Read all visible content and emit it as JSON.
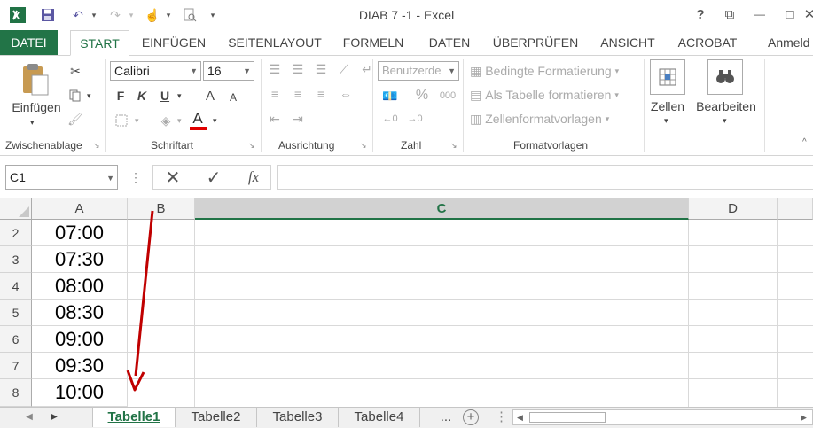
{
  "titlebar": {
    "title": "DIAB 7 -1 - Excel",
    "help": "?",
    "restore": "⧉",
    "minimize": "—",
    "maximize": "□",
    "close": "✕"
  },
  "tabs": {
    "datei": "DATEI",
    "start": "START",
    "einfuegen": "EINFÜGEN",
    "seitenlayout": "SEITENLAYOUT",
    "formeln": "FORMELN",
    "daten": "DATEN",
    "ueberpruefen": "ÜBERPRÜFEN",
    "ansicht": "ANSICHT",
    "acrobat": "ACROBAT",
    "anmelden": "Anmeld"
  },
  "ribbon": {
    "clipboard": {
      "paste_label": "Einfügen",
      "group": "Zwischenablage"
    },
    "font": {
      "name": "Calibri",
      "size": "16",
      "bold": "F",
      "italic": "K",
      "underline": "U",
      "grow": "A",
      "shrink": "A",
      "color_letter": "A",
      "group": "Schriftart"
    },
    "alignment": {
      "group": "Ausrichtung"
    },
    "number": {
      "format": "Benutzerde",
      "percent": "%",
      "thousands": "000",
      "group": "Zahl"
    },
    "styles": {
      "conditional": "Bedingte Formatierung",
      "as_table": "Als Tabelle formatieren",
      "cell_styles": "Zellenformatvorlagen",
      "group": "Formatvorlagen"
    },
    "cells": {
      "label": "Zellen"
    },
    "editing": {
      "label": "Bearbeiten"
    }
  },
  "formula_bar": {
    "name_box": "C1",
    "fx": "fx",
    "content": ""
  },
  "grid": {
    "columns": [
      {
        "label": "A"
      },
      {
        "label": "B"
      },
      {
        "label": "C"
      },
      {
        "label": "D"
      }
    ],
    "rows": [
      {
        "num": "2",
        "a": "07:00"
      },
      {
        "num": "3",
        "a": "07:30"
      },
      {
        "num": "4",
        "a": "08:00"
      },
      {
        "num": "5",
        "a": "08:30"
      },
      {
        "num": "6",
        "a": "09:00"
      },
      {
        "num": "7",
        "a": "09:30"
      },
      {
        "num": "8",
        "a": "10:00"
      }
    ]
  },
  "sheets": {
    "tabs": [
      "Tabelle1",
      "Tabelle2",
      "Tabelle3",
      "Tabelle4"
    ],
    "more": "...",
    "add": "+"
  },
  "colors": {
    "excel_green": "#217346",
    "arrow_red": "#c00000",
    "font_color_bar": "#e00000"
  }
}
